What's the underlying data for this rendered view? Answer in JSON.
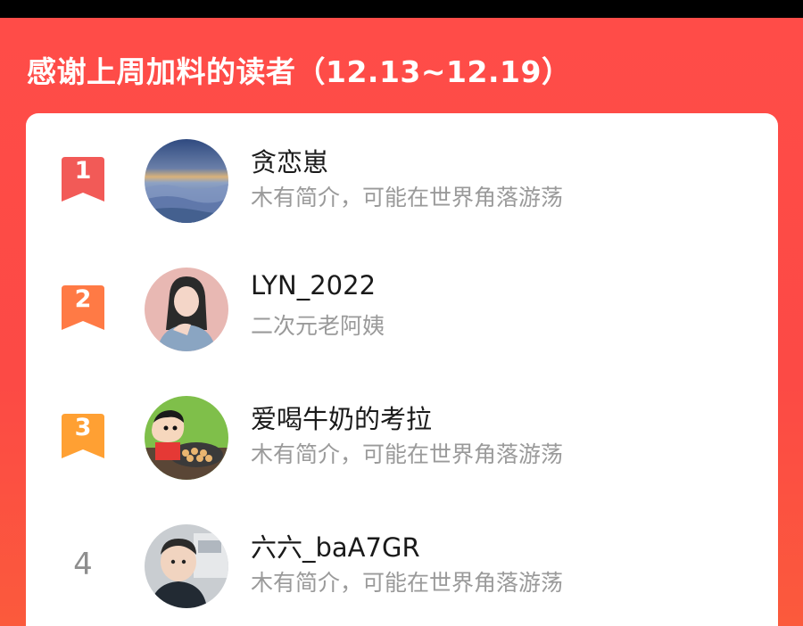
{
  "header": {
    "title": "感谢上周加料的读者（12.13~12.19）"
  },
  "readers": [
    {
      "rank": "1",
      "name": "贪恋崽",
      "bio": "木有简介，可能在世界角落游荡",
      "avatar": "sky-photo-avatar",
      "badge_color": "#f25a57"
    },
    {
      "rank": "2",
      "name": "LYN_2022",
      "bio": "二次元老阿姨",
      "avatar": "illustrated-woman-avatar",
      "badge_color": "#ff7a45"
    },
    {
      "rank": "3",
      "name": "爱喝牛奶的考拉",
      "bio": "木有简介，可能在世界角落游荡",
      "avatar": "cartoon-boy-avatar",
      "badge_color": "#ffa033"
    },
    {
      "rank": "4",
      "name": "六六_baA7GR",
      "bio": "木有简介，可能在世界角落游荡",
      "avatar": "child-photo-avatar"
    }
  ]
}
